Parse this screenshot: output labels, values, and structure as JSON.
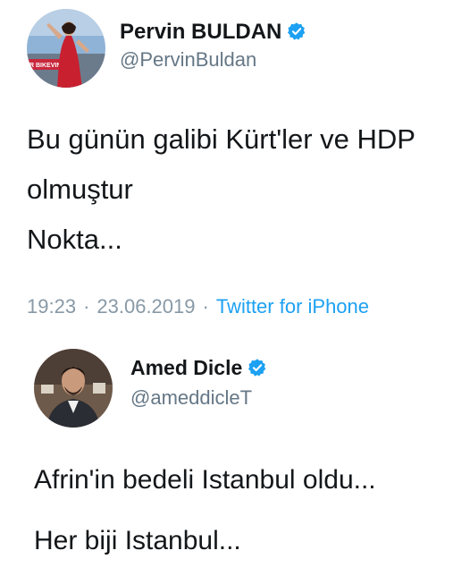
{
  "tweets": [
    {
      "display_name": "Pervin BULDAN",
      "handle": "@PervinBuldan",
      "avatar_banner_text": "R BIKEVIN",
      "body_lines": [
        "Bu günün galibi Kürt'ler ve HDP",
        "olmuştur",
        "Nokta..."
      ],
      "time": "19:23",
      "date": "23.06.2019",
      "source": "Twitter for iPhone"
    },
    {
      "display_name": "Amed Dicle",
      "handle": "@ameddicleT",
      "body_lines": [
        "Afrin'in bedeli Istanbul oldu...",
        "Her biji Istanbul..."
      ]
    }
  ],
  "colors": {
    "verified": "#1da1f2",
    "handle": "#657786",
    "meta": "#8899a6",
    "link": "#1da1f2"
  },
  "icons": {
    "verified": "verified-badge-icon",
    "separator": "·"
  }
}
